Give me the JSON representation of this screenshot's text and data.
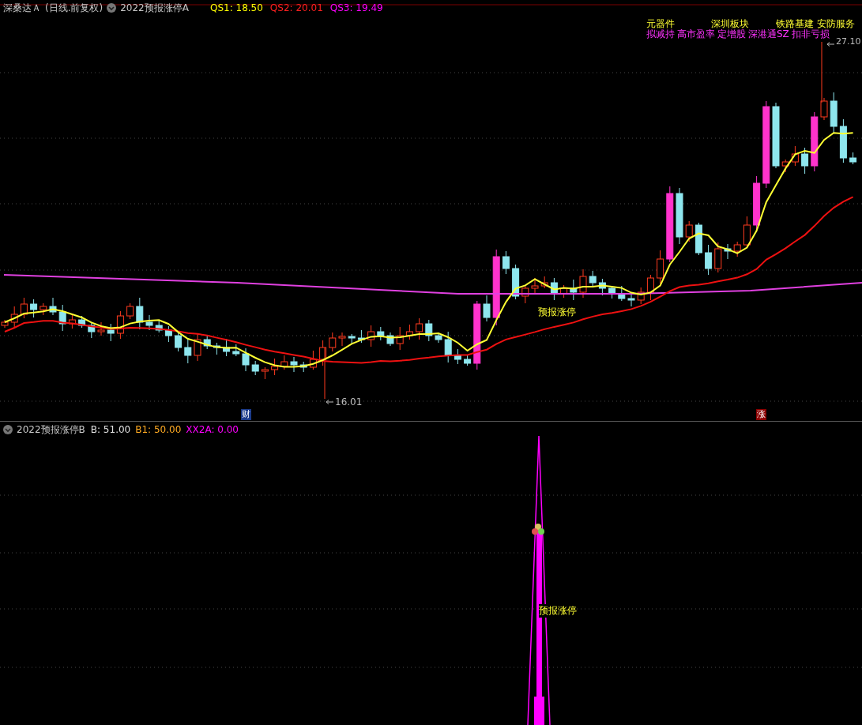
{
  "top_panel": {
    "stock_name": "深桑达Ａ",
    "period": "(日线.前复权)",
    "indicator": "2022预报涨停A",
    "values": [
      {
        "label": "QS1: 18.50",
        "color": "#ffff00"
      },
      {
        "label": "QS2: 20.01",
        "color": "#ff2020"
      },
      {
        "label": "QS3: 19.49",
        "color": "#ff00ff"
      }
    ],
    "sector_tags": [
      "元器件",
      "深圳板块",
      "铁路基建",
      "安防服务"
    ],
    "event_tags": [
      "拟减持",
      "高市盈率",
      "定增股",
      "深港通SZ",
      "扣非亏损"
    ],
    "high_label": "27.10",
    "low_label": "16.01",
    "signal_label": "预报涨停",
    "markers": [
      {
        "text": "财",
        "kind": "finance"
      },
      {
        "text": "涨",
        "kind": "limit"
      }
    ]
  },
  "bottom_panel": {
    "indicator": "2022预报涨停B",
    "values": [
      {
        "label": "B: 51.00",
        "color": "#e0e0e0"
      },
      {
        "label": "B1: 50.00",
        "color": "#ffaa22"
      },
      {
        "label": "XX2A: 0.00",
        "color": "#ff00ff"
      }
    ],
    "signal_label": "预报涨停"
  }
}
